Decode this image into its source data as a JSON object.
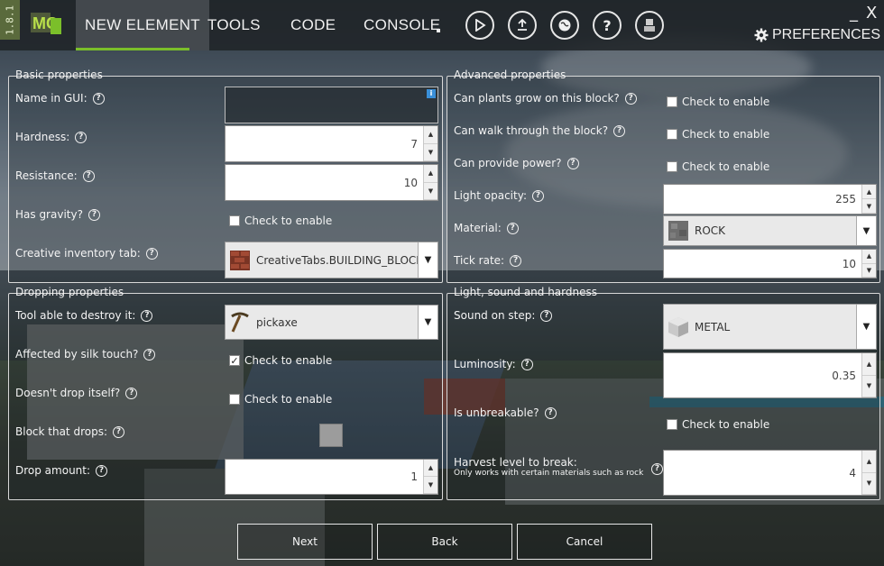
{
  "app": {
    "version": "1.8.1",
    "logo_text": "MC"
  },
  "menu": {
    "items": [
      {
        "label": "NEW ELEMENT"
      },
      {
        "label": "TOOLS"
      },
      {
        "label": "CODE"
      },
      {
        "label": "CONSOLE"
      }
    ],
    "tool_icons": [
      "play-icon",
      "export-icon",
      "globe-icon",
      "help-icon",
      "user-icon"
    ],
    "preferences_label": "PREFERENCES",
    "minimize_label": "_",
    "close_label": "X"
  },
  "basic": {
    "title": "Basic properties",
    "name_label": "Name in GUI:",
    "name_value": "",
    "hardness_label": "Hardness:",
    "hardness_value": "7",
    "resistance_label": "Resistance:",
    "resistance_value": "10",
    "gravity_label": "Has gravity?",
    "gravity_check": "Check to enable",
    "creative_label": "Creative inventory tab:",
    "creative_value": "CreativeTabs.BUILDING_BLOCKS"
  },
  "advanced": {
    "title": "Advanced properties",
    "plants_label": "Can plants grow on this block?",
    "plants_check": "Check to enable",
    "walk_label": "Can walk through the block?",
    "walk_check": "Check to enable",
    "power_label": "Can provide power?",
    "power_check": "Check to enable",
    "opacity_label": "Light opacity:",
    "opacity_value": "255",
    "material_label": "Material:",
    "material_value": "ROCK",
    "tick_label": "Tick rate:",
    "tick_value": "10"
  },
  "dropping": {
    "title": "Dropping properties",
    "tool_label": "Tool able to destroy it:",
    "tool_value": "pickaxe",
    "silk_label": "Affected by silk touch?",
    "silk_check": "Check to enable",
    "silk_checked": true,
    "drop_self_label": "Doesn't drop itself?",
    "drop_self_check": "Check to enable",
    "block_drops_label": "Block that drops:",
    "amount_label": "Drop amount:",
    "amount_value": "1"
  },
  "light": {
    "title": "Light, sound and hardness",
    "sound_label": "Sound on step:",
    "sound_value": "METAL",
    "lum_label": "Luminosity:",
    "lum_value": "0.35",
    "unbreak_label": "Is unbreakable?",
    "unbreak_check": "Check to enable",
    "harvest_label": "Harvest level to break:",
    "harvest_sub": "Only works with certain materials such as rock",
    "harvest_value": "4"
  },
  "buttons": {
    "next": "Next",
    "back": "Back",
    "cancel": "Cancel"
  }
}
